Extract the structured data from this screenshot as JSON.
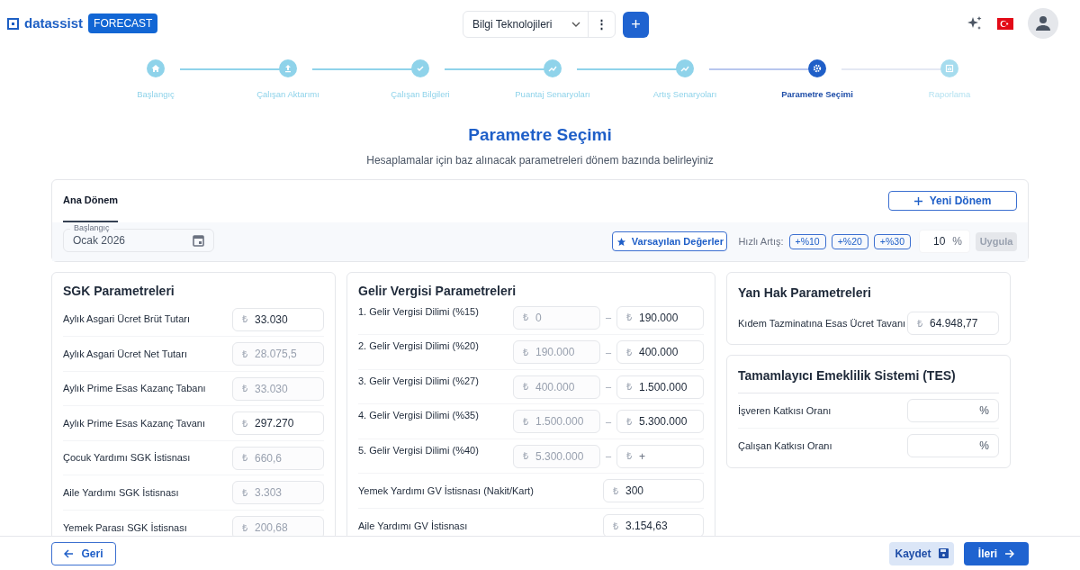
{
  "header": {
    "logo": "datassist",
    "badge": "FORECAST",
    "company": "Bilgi Teknolojileri",
    "more": "⋮",
    "add": "+"
  },
  "steps": [
    {
      "label": "Başlangıç",
      "completed": true,
      "selected": false
    },
    {
      "label": "Çalışan Aktarımı",
      "completed": true,
      "selected": false
    },
    {
      "label": "Çalışan Bilgileri",
      "completed": true,
      "selected": false
    },
    {
      "label": "Puantaj Senaryoları",
      "completed": true,
      "selected": false
    },
    {
      "label": "Artış Senaryoları",
      "completed": true,
      "selected": false
    },
    {
      "label": "Parametre Seçimi",
      "completed": false,
      "selected": true
    },
    {
      "label": "Raporlama",
      "completed": false,
      "selected": false
    }
  ],
  "title": "Parametre Seçimi",
  "subtitle": "Hesaplamalar için baz alınacak parametreleri dönem bazında belirleyiniz",
  "period_tabs": [
    {
      "label": "Ana Dönem",
      "selected": true
    }
  ],
  "new_period_button": "Yeni Dönem",
  "start_field": {
    "label": "Başlangıç",
    "value": "Ocak 2026"
  },
  "defaults_button": "Varsayılan Değerler",
  "quick_increase": {
    "label": "Hızlı Artış:",
    "options": [
      "+%10",
      "+%20",
      "+%30"
    ],
    "value": "10",
    "unit": "%",
    "apply": "Uygula",
    "apply_disabled": true
  },
  "sgk": {
    "title": "SGK Parametreleri",
    "rows": [
      {
        "label": "Aylık Asgari Ücret Brüt Tutarı",
        "currency": "₺",
        "value": "33.030",
        "disabled": false
      },
      {
        "label": "Aylık Asgari Ücret Net Tutarı",
        "currency": "₺",
        "value": "28.075,5",
        "disabled": true
      },
      {
        "label": "Aylık Prime Esas Kazanç Tabanı",
        "currency": "₺",
        "value": "33.030",
        "disabled": true
      },
      {
        "label": "Aylık Prime Esas Kazanç Tavanı",
        "currency": "₺",
        "value": "297.270",
        "disabled": false
      },
      {
        "label": "Çocuk Yardımı SGK İstisnası",
        "currency": "₺",
        "value": "660,6",
        "disabled": true
      },
      {
        "label": "Aile Yardımı SGK İstisnası",
        "currency": "₺",
        "value": "3.303",
        "disabled": true
      },
      {
        "label": "Yemek Parası SGK İstisnası",
        "currency": "₺",
        "value": "200,68",
        "disabled": true
      }
    ]
  },
  "income_tax": {
    "title": "Gelir Vergisi Parametreleri",
    "rows": [
      {
        "kind": "range",
        "label": "1. Gelir Vergisi Dilimi (%15)",
        "from": {
          "currency": "₺",
          "value": "0",
          "disabled": true
        },
        "separator": "–",
        "to": {
          "currency": "₺",
          "value": "190.000",
          "disabled": false
        }
      },
      {
        "kind": "range",
        "label": "2. Gelir Vergisi Dilimi (%20)",
        "from": {
          "currency": "₺",
          "value": "190.000",
          "disabled": true
        },
        "separator": "–",
        "to": {
          "currency": "₺",
          "value": "400.000",
          "disabled": false
        }
      },
      {
        "kind": "range",
        "label": "3. Gelir Vergisi Dilimi (%27)",
        "from": {
          "currency": "₺",
          "value": "400.000",
          "disabled": true
        },
        "separator": "–",
        "to": {
          "currency": "₺",
          "value": "1.500.000",
          "disabled": false
        }
      },
      {
        "kind": "range",
        "label": "4. Gelir Vergisi Dilimi (%35)",
        "from": {
          "currency": "₺",
          "value": "1.500.000",
          "disabled": true
        },
        "separator": "–",
        "to": {
          "currency": "₺",
          "value": "5.300.000",
          "disabled": false
        }
      },
      {
        "kind": "range",
        "label": "5. Gelir Vergisi Dilimi (%40)",
        "from": {
          "currency": "₺",
          "value": "5.300.000",
          "disabled": true
        },
        "separator": "–",
        "to": {
          "currency": "₺",
          "placeholder": "+"
        }
      },
      {
        "kind": "single",
        "label": "Yemek Yardımı GV İstisnası (Nakit/Kart)",
        "field": {
          "currency": "₺",
          "value": "300",
          "disabled": false
        }
      },
      {
        "kind": "single",
        "label": "Aile Yardımı GV İstisnası",
        "field": {
          "currency": "₺",
          "value": "3.154,63",
          "disabled": false
        }
      }
    ]
  },
  "side_benefits": {
    "title": "Yan Hak Parametreleri",
    "rows": [
      {
        "label": "Kıdem Tazminatına Esas Ücret Tavanı",
        "currency": "₺",
        "value": "64.948,77",
        "disabled": false
      }
    ]
  },
  "tes": {
    "title": "Tamamlayıcı Emeklilik Sistemi (TES)",
    "rows": [
      {
        "label": "İşveren Katkısı Oranı",
        "unit": "%"
      },
      {
        "label": "Çalışan Katkısı Oranı",
        "unit": "%"
      }
    ]
  },
  "footer": {
    "back": "Geri",
    "save": "Kaydet",
    "next": "İleri"
  }
}
